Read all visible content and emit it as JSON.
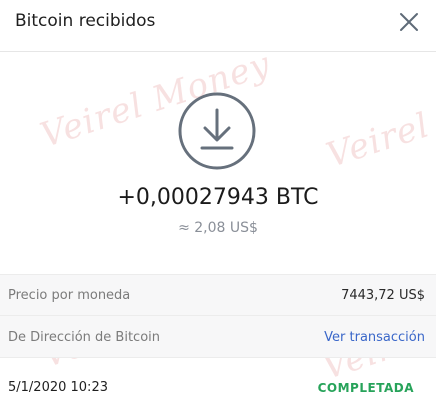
{
  "header": {
    "title": "Bitcoin recibidos"
  },
  "watermark": {
    "text": "Veirel Money"
  },
  "transaction": {
    "amount": "+0,00027943 BTC",
    "fiat": "≈ 2,08 US$"
  },
  "details": [
    {
      "label": "Precio por moneda",
      "value": "7443,72 US$"
    },
    {
      "label": "De Dirección de Bitcoin",
      "link": "Ver transacción"
    }
  ],
  "footer": {
    "date": "5/1/2020 10:23",
    "status": "COMPLETADA"
  },
  "colors": {
    "status": "#27a35a",
    "link": "#3a67c9",
    "icon": "#66707c"
  },
  "icons": {
    "close": "close-icon",
    "receive": "download-arrow-icon"
  }
}
